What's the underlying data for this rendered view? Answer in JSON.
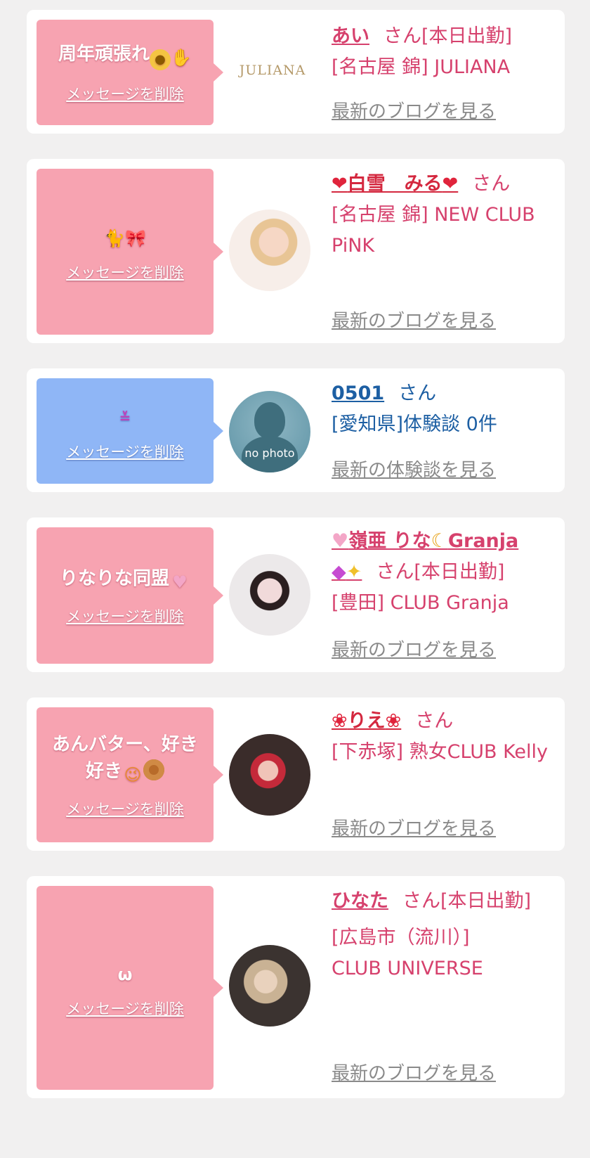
{
  "delete_label": "メッセージを削除",
  "san_label": "さん",
  "cards": [
    {
      "message": "周年頑張れ",
      "name": "あい",
      "status": "[本日出勤]",
      "area_shop": "[名古屋 錦] JULIANA",
      "logo_text": "JULIANA",
      "link": "最新のブログを見る"
    },
    {
      "name": "白雪　みる",
      "area_shop": "[名古屋 錦] NEW CLUB PiNK",
      "link": "最新のブログを見る"
    },
    {
      "name": "0501",
      "area_shop": "[愛知県]体験談 0件",
      "nophoto": "no photo",
      "link": "最新の体験談を見る"
    },
    {
      "message": "りなりな同盟",
      "name": "嶺亜 りな",
      "name_suffix": "Granja",
      "status": "[本日出勤]",
      "area_shop": "[豊田] CLUB Granja",
      "link": "最新のブログを見る"
    },
    {
      "message": "あんバター、好き好き",
      "name": "りえ",
      "area_shop": "[下赤塚] 熟女CLUB Kelly",
      "link": "最新のブログを見る"
    },
    {
      "name": "ひなた",
      "status": "[本日出勤]",
      "area_shop": "[広島市（流川）] CLUB UNIVERSE",
      "link": "最新のブログを見る"
    }
  ],
  "colors": {
    "pink_bubble": "#f7a3b1",
    "blue_bubble": "#8fb6f6",
    "pink_text": "#d6416d",
    "blue_text": "#1d5fa3"
  }
}
